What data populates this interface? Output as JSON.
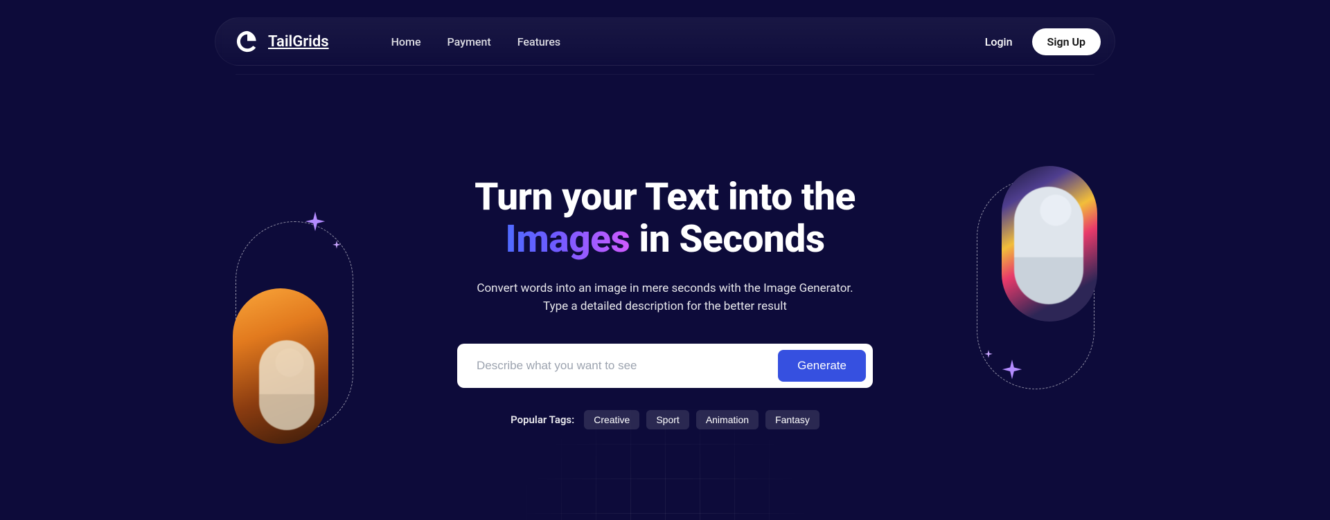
{
  "brand": {
    "name": "TailGrids"
  },
  "nav": {
    "items": [
      {
        "label": "Home"
      },
      {
        "label": "Payment"
      },
      {
        "label": "Features"
      }
    ]
  },
  "auth": {
    "login": "Login",
    "signup": "Sign Up"
  },
  "hero": {
    "title_line1": "Turn your Text into the",
    "title_gradient_word": "Images",
    "title_line2_rest": " in Seconds",
    "subtitle": "Convert words into an image in mere seconds with the Image Generator. Type a detailed description for the better result"
  },
  "prompt": {
    "placeholder": "Describe what you want to see",
    "button": "Generate"
  },
  "tags": {
    "label": "Popular Tags:",
    "items": [
      "Creative",
      "Sport",
      "Animation",
      "Fantasy"
    ]
  }
}
